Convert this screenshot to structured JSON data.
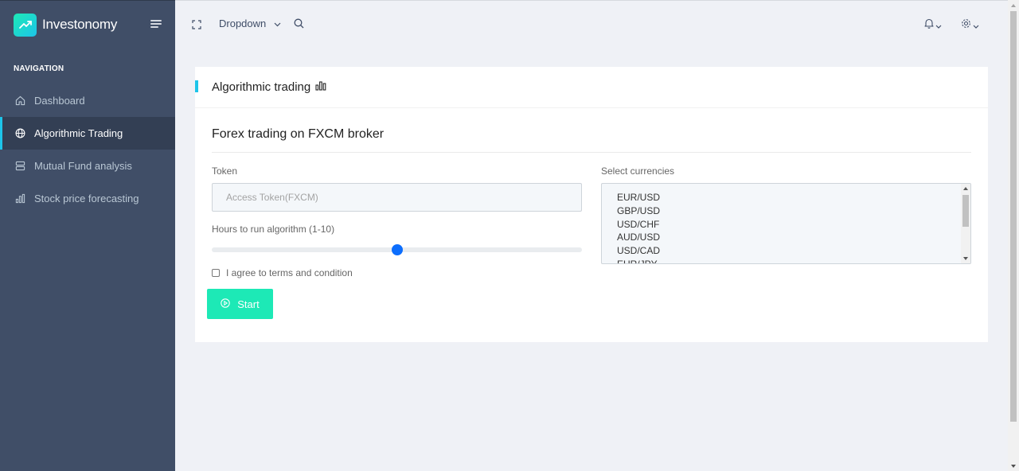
{
  "brand": {
    "name": "Investonomy"
  },
  "sidebar": {
    "caption": "NAVIGATION",
    "items": [
      {
        "label": "Dashboard",
        "icon": "home-icon",
        "active": false
      },
      {
        "label": "Algorithmic Trading",
        "icon": "globe-icon",
        "active": true
      },
      {
        "label": "Mutual Fund analysis",
        "icon": "server-icon",
        "active": false
      },
      {
        "label": "Stock price forecasting",
        "icon": "bar-chart-icon",
        "active": false
      }
    ]
  },
  "header": {
    "dropdown_label": "Dropdown"
  },
  "card": {
    "title": "Algorithmic trading",
    "subtitle": "Forex trading on FXCM broker",
    "token": {
      "label": "Token",
      "placeholder": "Access Token(FXCM)",
      "value": ""
    },
    "hours": {
      "label": "Hours to run algorithm (1-10)",
      "min": 1,
      "max": 10,
      "value": 5.5
    },
    "agree_label": "I agree to terms and condition",
    "start_label": "Start",
    "currencies": {
      "label": "Select currencies",
      "options": [
        "EUR/USD",
        "GBP/USD",
        "USD/CHF",
        "AUD/USD",
        "USD/CAD",
        "EUR/JPY"
      ]
    }
  },
  "colors": {
    "sidebar": "#404e67",
    "accent": "#1dc4e9",
    "button": "#1de9b6",
    "slider": "#0d6efd"
  }
}
